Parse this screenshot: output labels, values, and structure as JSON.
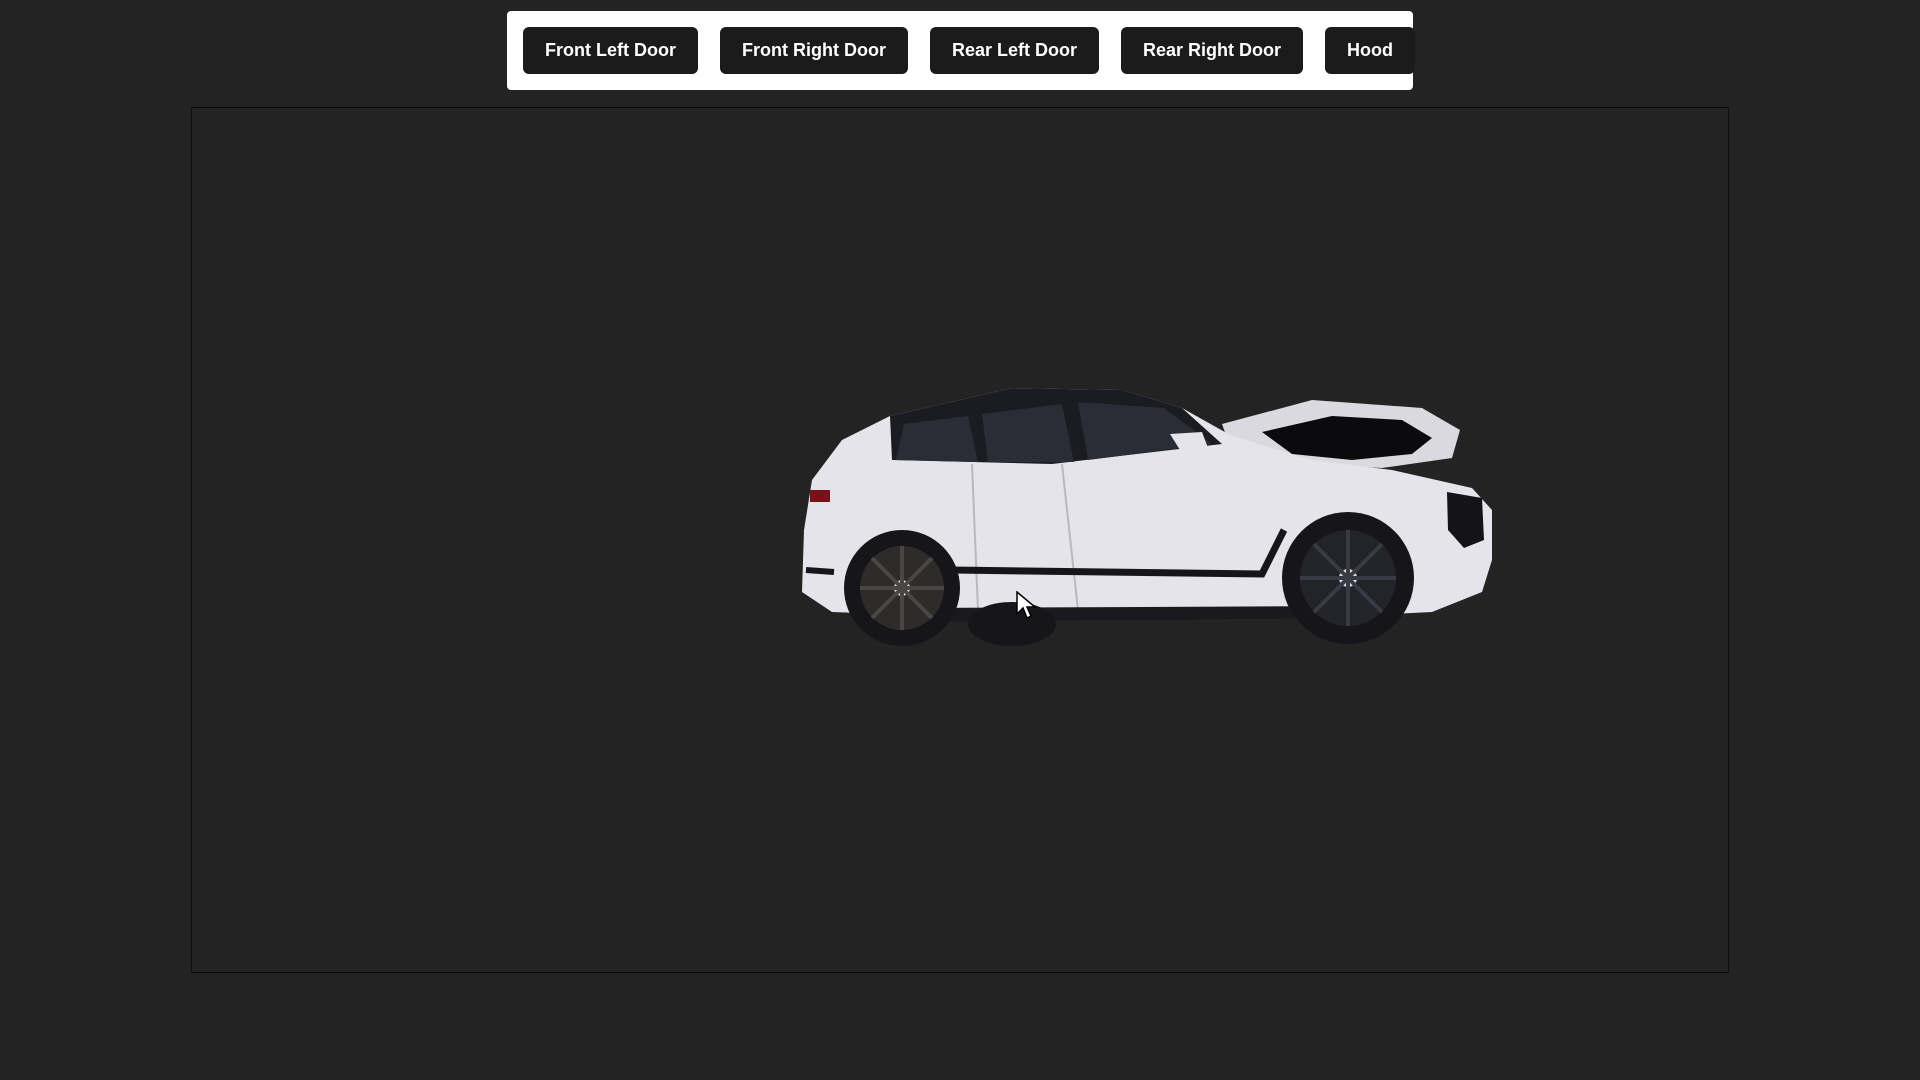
{
  "toolbar": {
    "buttons": [
      {
        "label": "Front Left Door"
      },
      {
        "label": "Front Right Door"
      },
      {
        "label": "Rear Left Door"
      },
      {
        "label": "Rear Right Door"
      },
      {
        "label": "Hood"
      }
    ]
  },
  "scene": {
    "background_color": "#232323",
    "car_color": "#e4e4ea",
    "wheel_color": "#15151a",
    "hood_state": "open"
  },
  "icons": {
    "car": "suv-3d-model",
    "cursor": "mouse-pointer"
  }
}
